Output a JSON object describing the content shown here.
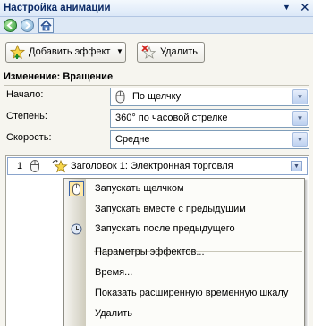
{
  "pane": {
    "title": "Настройка анимации",
    "dropdown_glyph": "▼",
    "close_glyph": "✕"
  },
  "nav": {
    "back_icon": "arrow-left-icon",
    "forward_icon": "arrow-right-icon",
    "home_icon": "home-icon"
  },
  "toolbar": {
    "add_effect_label": "Добавить эффект",
    "add_effect_arrow": "▼",
    "remove_label": "Удалить"
  },
  "section": {
    "title": "Изменение: Вращение"
  },
  "fields": {
    "start": {
      "label": "Начало:",
      "value": "По щелчку"
    },
    "amount": {
      "label": "Степень:",
      "value": "360° по часовой стрелке"
    },
    "speed": {
      "label": "Скорость:",
      "value": "Средне"
    }
  },
  "effect_list": {
    "items": [
      {
        "number": "1",
        "title": "Заголовок 1: Электронная торговля"
      }
    ]
  },
  "context_menu": {
    "items": [
      {
        "label": "Запускать щелчком",
        "icon": "mouse-icon",
        "checked": true
      },
      {
        "label": "Запускать вместе с предыдущим",
        "icon": "",
        "checked": false
      },
      {
        "label": "Запускать после предыдущего",
        "icon": "clock-icon",
        "checked": false
      },
      {
        "label": "Параметры эффектов...",
        "icon": "",
        "checked": false
      },
      {
        "label": "Время...",
        "icon": "",
        "checked": false
      },
      {
        "label": "Показать расширенную временную шкалу",
        "icon": "",
        "checked": false
      },
      {
        "label": "Удалить",
        "icon": "",
        "checked": false
      }
    ]
  },
  "colors": {
    "title_text": "#0b2a66",
    "pane_background": "#f6f5ef",
    "nav_back": "#2f9a3a",
    "menu_checked_background": "#ffe9a6",
    "menu_checked_border": "#3b63a7"
  }
}
